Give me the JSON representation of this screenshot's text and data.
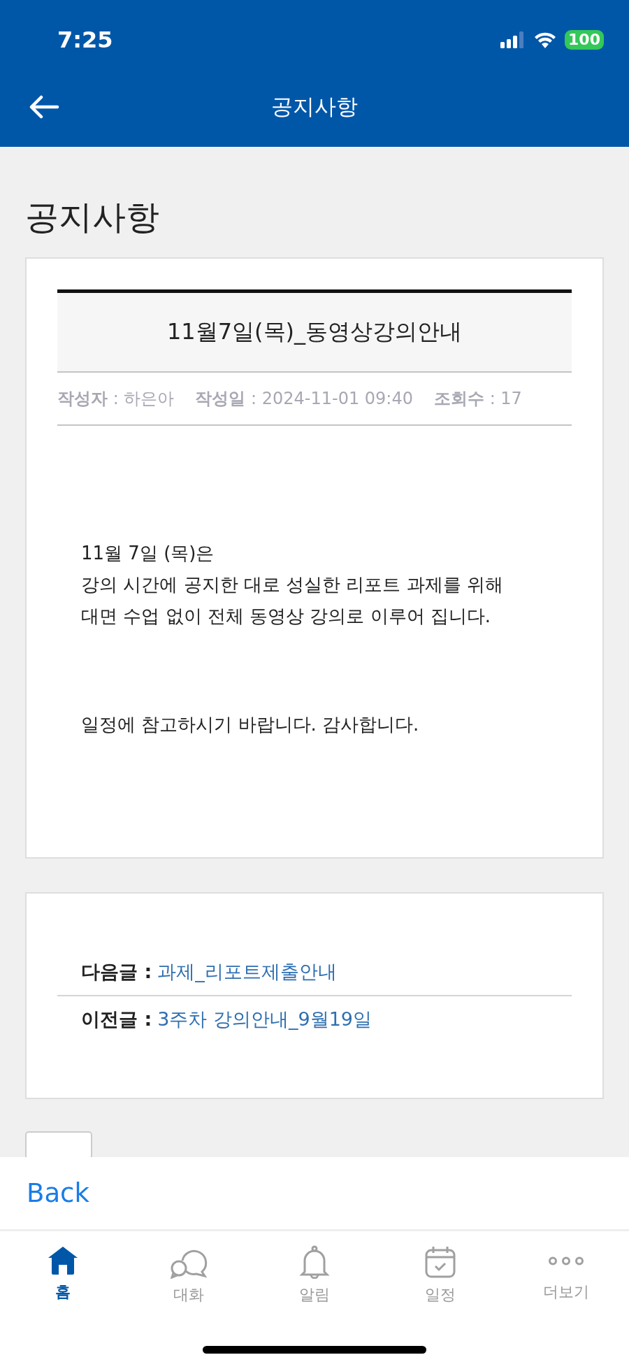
{
  "status_bar": {
    "time": "7:25",
    "battery": "100"
  },
  "header": {
    "title": "공지사항"
  },
  "page_title": "공지사항",
  "notice": {
    "title": "11월7일(목)_동영상강의안내",
    "meta": [
      {
        "label": "작성자",
        "value": ": 하은아"
      },
      {
        "label": "작성일",
        "value": ": 2024-11-01 09:40"
      },
      {
        "label": "조회수",
        "value": ": 17"
      }
    ],
    "paragraphs": [
      [
        "11월 7일 (목)은",
        "강의 시간에 공지한 대로 성실한 리포트 과제를 위해",
        "대면 수업 없이 전체 동영상 강의로 이루어 집니다."
      ],
      [
        "일정에 참고하시기 바랍니다. 감사합니다."
      ]
    ]
  },
  "navigation": [
    {
      "label": "다음글 :",
      "link": "과제_리포트제출안내"
    },
    {
      "label": "이전글 :",
      "link": "3주차 강의안내_9월19일"
    }
  ],
  "back_bar": {
    "label": "Back"
  },
  "tabs": [
    {
      "kind": "home",
      "label": "홈",
      "selected": true
    },
    {
      "kind": "chat",
      "label": "대화",
      "selected": false
    },
    {
      "kind": "bell",
      "label": "알림",
      "selected": false
    },
    {
      "kind": "calendar",
      "label": "일정",
      "selected": false
    },
    {
      "kind": "more",
      "label": "더보기",
      "selected": false
    }
  ]
}
